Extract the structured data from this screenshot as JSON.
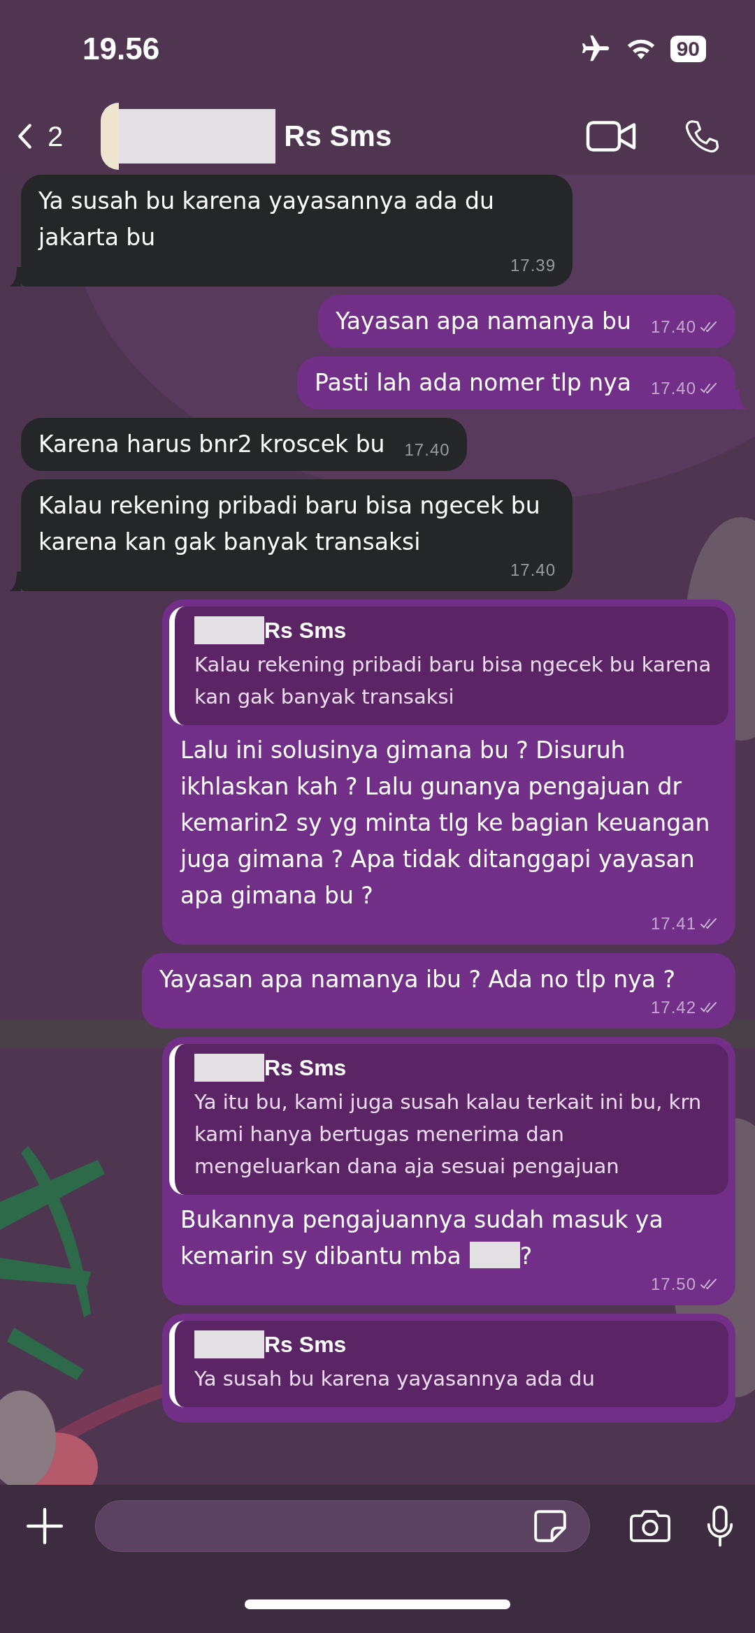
{
  "status_bar": {
    "time": "19.56",
    "airplane_mode": true,
    "battery": "90"
  },
  "header": {
    "back_count": "2",
    "name_redacted": true,
    "title": "Rs Sms"
  },
  "messages": [
    {
      "kind": "incoming",
      "text": "Ya susah bu karena yayasannya ada du jakarta bu",
      "time": "17.39",
      "tail": true
    },
    {
      "kind": "outgoing",
      "text": "Yayasan apa namanya bu",
      "time": "17.40",
      "read": true,
      "tail": false
    },
    {
      "kind": "outgoing",
      "text": "Pasti lah ada nomer tlp nya",
      "time": "17.40",
      "read": true,
      "tail": true
    },
    {
      "kind": "incoming",
      "text": "Karena harus bnr2 kroscek bu",
      "time": "17.40",
      "tail": false
    },
    {
      "kind": "incoming",
      "text": "Kalau rekening pribadi baru bisa ngecek bu karena kan gak banyak transaksi",
      "time": "17.40",
      "tail": true
    },
    {
      "kind": "outgoing",
      "reply": {
        "author": "Rs Sms",
        "author_redacted": true,
        "text": "Kalau rekening pribadi baru bisa ngecek bu karena kan gak banyak transaksi"
      },
      "text": "Lalu ini solusinya gimana bu ? Disuruh ikhlaskan kah ? Lalu gunanya pengajuan dr kemarin2 sy yg minta tlg ke bagian keuangan juga gimana ? Apa tidak ditanggapi yayasan apa gimana bu ?",
      "time": "17.41",
      "read": true,
      "tail": false
    },
    {
      "kind": "outgoing",
      "text": "Yayasan apa namanya ibu ? Ada no tlp nya ?",
      "time": "17.42",
      "read": true,
      "tail": false
    },
    {
      "kind": "outgoing",
      "reply": {
        "author": "Rs Sms",
        "author_redacted": true,
        "text": "Ya itu bu, kami juga susah kalau terkait ini bu, krn kami hanya bertugas menerima dan mengeluarkan dana aja sesuai pengajuan"
      },
      "text": "Bukannya pengajuannya sudah masuk ya kemarin sy dibantu mba",
      "text_after_redaction": "?",
      "time": "17.50",
      "read": true,
      "tail": false
    },
    {
      "kind": "outgoing",
      "reply": {
        "author": "Rs Sms",
        "author_redacted": true,
        "text": "Ya susah bu karena yayasannya ada du"
      },
      "tail": false
    }
  ]
}
